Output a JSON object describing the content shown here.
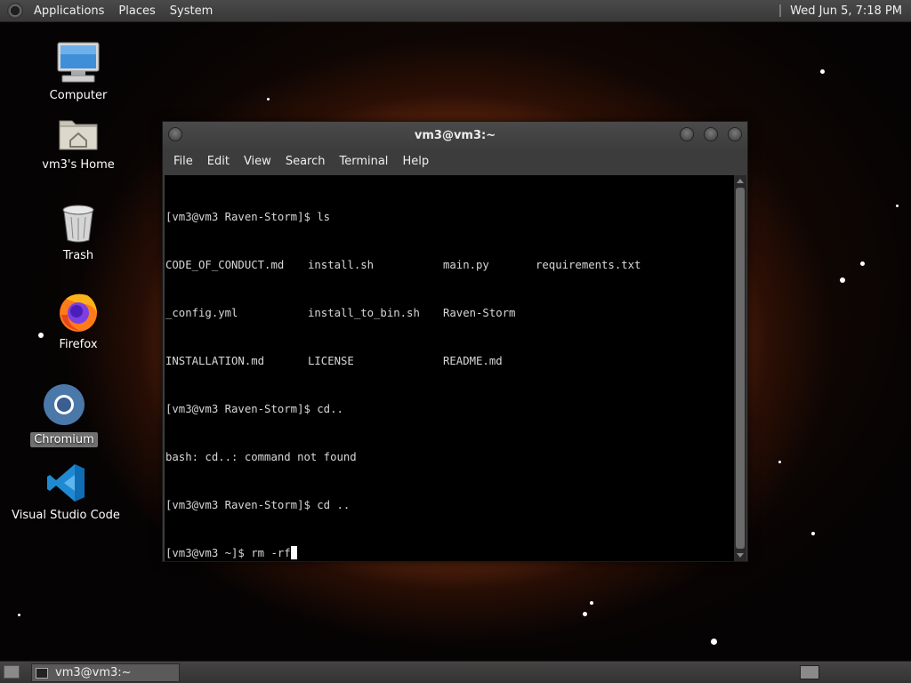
{
  "top_panel": {
    "menus": [
      "Applications",
      "Places",
      "System"
    ],
    "clock": "Wed Jun  5,  7:18 PM"
  },
  "desktop_icons": [
    {
      "label": "Computer",
      "icon": "computer-icon"
    },
    {
      "label": "vm3's Home",
      "icon": "home-folder-icon"
    },
    {
      "label": "Trash",
      "icon": "trash-icon"
    },
    {
      "label": "Firefox",
      "icon": "firefox-icon"
    },
    {
      "label": "Chromium",
      "icon": "chromium-icon"
    },
    {
      "label": "Visual Studio Code",
      "icon": "vscode-icon"
    }
  ],
  "terminal": {
    "title": "vm3@vm3:~",
    "menus": [
      "File",
      "Edit",
      "View",
      "Search",
      "Terminal",
      "Help"
    ],
    "lines": [
      "[vm3@vm3 Raven-Storm]$ ls",
      "bash: cd..: command not found",
      "[vm3@vm3 Raven-Storm]$ cd ..",
      "[vm3@vm3 ~]$ rm -rf"
    ],
    "ls_output": [
      [
        "CODE_OF_CONDUCT.md",
        "install.sh",
        "main.py",
        "requirements.txt"
      ],
      [
        "_config.yml",
        "install_to_bin.sh",
        "Raven-Storm",
        ""
      ],
      [
        "INSTALLATION.md",
        "LICENSE",
        "README.md",
        ""
      ]
    ],
    "cd_line": "[vm3@vm3 Raven-Storm]$ cd.."
  },
  "taskbar": {
    "window_label": "vm3@vm3:~"
  }
}
